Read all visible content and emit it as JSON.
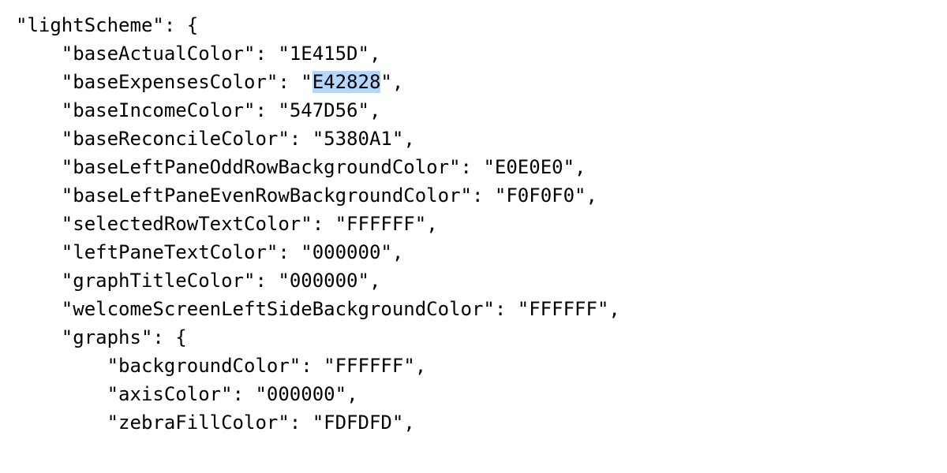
{
  "scheme_key": "lightScheme",
  "entries": [
    {
      "key": "baseActualColor",
      "value": "1E415D"
    },
    {
      "key": "baseExpensesColor",
      "value": "E42828",
      "selected": true
    },
    {
      "key": "baseIncomeColor",
      "value": "547D56"
    },
    {
      "key": "baseReconcileColor",
      "value": "5380A1"
    },
    {
      "key": "baseLeftPaneOddRowBackgroundColor",
      "value": "E0E0E0"
    },
    {
      "key": "baseLeftPaneEvenRowBackgroundColor",
      "value": "F0F0F0"
    },
    {
      "key": "selectedRowTextColor",
      "value": "FFFFFF"
    },
    {
      "key": "leftPaneTextColor",
      "value": "000000"
    },
    {
      "key": "graphTitleColor",
      "value": "000000"
    },
    {
      "key": "welcomeScreenLeftSideBackgroundColor",
      "value": "FFFFFF"
    }
  ],
  "graphs_key": "graphs",
  "graphs_entries": [
    {
      "key": "backgroundColor",
      "value": "FFFFFF"
    },
    {
      "key": "axisColor",
      "value": "000000"
    },
    {
      "key": "zebraFillColor",
      "value": "FDFDFD"
    }
  ]
}
